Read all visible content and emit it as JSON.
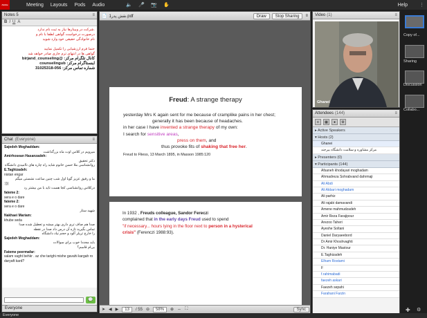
{
  "topbar": {
    "logo": "Adobe",
    "menu": [
      "Meeting",
      "Layouts",
      "Pods",
      "Audio"
    ],
    "help": "Help"
  },
  "notes": {
    "title": "Notes 5",
    "lines": [
      {
        "text": ".شرکت در وبینارها نیاز به ثبت نام ندارد",
        "style": "red"
      },
      {
        "text": "درصورت درخواست گواهی لطفا با نام و",
        "style": "red"
      },
      {
        "text": "نام خانوادگی حقیقی خود وارد شوید",
        "style": "red"
      },
      {
        "text": "",
        "style": ""
      },
      {
        "text": "حتما فرم ارزشیابی را تکمیل نمایید",
        "style": "red"
      },
      {
        "text": "گواهی ها در انتهای ترم جاری صادر خواهد شد",
        "style": "red"
      },
      {
        "text": "کانال تلگرام مرکز: @birjand_counseling",
        "style": "b"
      },
      {
        "text": "اینستاگرام مرکز: counselingub",
        "style": "b"
      },
      {
        "text": "شماره تماس مرکز: 056-31025318",
        "style": "b"
      }
    ]
  },
  "chat": {
    "title": "Chat",
    "scope": "(Everyone)",
    "tab": "Everyone",
    "messages": [
      {
        "who": "Sajedeh Moghaddam:",
        "text": "میرویم در کلاس اوت ماه بزرگداشت",
        "dir": "rtl"
      },
      {
        "who": "Amirhosean Hasanzadeh:",
        "text": "دکتر تحقیق",
        "dir": "rtl"
      },
      {
        "who": "",
        "text": "روانشناسی ملا حسن خانوم شاید راه چاره های ناامیدی دانشگاه",
        "dir": "rtl"
      },
      {
        "who": "E.Taghizadeh:",
        "text": "nistan engar",
        "dir": "ltr"
      },
      {
        "who": "",
        "text": "ما و رفیق عزیز گویا اول شب چنین ساعت نشستی میگم",
        "dir": "rtl"
      },
      {
        "who": "",
        "text": ":)))",
        "dir": "ltr"
      },
      {
        "who": "",
        "text": "درکلاس روانشناسی کجا هست تاید با من بیشتر رد",
        "dir": "rtl"
      },
      {
        "who": "fateme 2:",
        "text": "sera e o dare",
        "dir": "ltr"
      },
      {
        "who": "fateme 2:",
        "text": "sera e o dare",
        "dir": "ltr"
      },
      {
        "who": "",
        "text": "شهید ستار",
        "dir": "rtl"
      },
      {
        "who": "Nakhaei Mariam:",
        "text": "khube seda",
        "dir": "ltr"
      },
      {
        "who": "",
        "text": "صدا هم صاف تری داری بهتر میشه و تعطیل شده صدا",
        "dir": "rtl"
      },
      {
        "who": "",
        "text": "تماس بگیرید تازه آن درس داد صدا در نقطه",
        "dir": "rtl"
      },
      {
        "who": "",
        "text": "را خارج تریلر آلود و حجم نیاد دانشگاه",
        "dir": "rtl"
      },
      {
        "who": "Sajedeh Moghaddam:",
        "text": "باید مجددا خوب برای سوالات",
        "dir": "rtl"
      },
      {
        "who": "",
        "text": "بی‌ام قاسم؟",
        "dir": "rtl"
      },
      {
        "who": "Fateme peermafar:",
        "text": "salam vaght behkr . az che tarighi mishe gavahi kargah ro daryaft kard?",
        "dir": "ltr"
      }
    ]
  },
  "share": {
    "filename": "نقش پدر1.pdf",
    "draw_label": "Draw",
    "stop_label": "Stop Sharing",
    "page_current": "13",
    "page_total": "/ 55",
    "zoom": "58%",
    "sync_label": "Sync"
  },
  "slide1": {
    "title_bold": "Freud",
    "title_rest": ": A strange therapy",
    "l1": "yesterday Mrs K again sent for me because of cramplike pains in her chest;",
    "l2": "generally it has been because of headaches.",
    "l3a": "in her case I have ",
    "l3b": "invented a strange therapy",
    "l3c": " of my own:",
    "l4a": "I search for ",
    "l4b": "sensitive areas",
    "l4c": ",",
    "l5a": "press on them",
    "l5b": ", and",
    "l6a": "thus ",
    "l6b": "provoke fits of ",
    "l6c": "shaking that free her",
    "l6d": ".",
    "cite": "Freud to Fliess, 13 March 1895, in Masson 1985:120"
  },
  "slide2": {
    "l1a": "In 1932 , ",
    "l1b": "Freuds colleague, Sandor Ferecz",
    "l1c": "i",
    "l2a": "complained that ",
    "l2b": "in the early days Freud",
    "l2c": " used to spend",
    "l3a": "\"if necessary... hours lying in the floor next to ",
    "l3b": "person in a hysterical",
    "l4a": "crisis\"",
    "l4b": " (Ferenczi 1988:93)."
  },
  "video": {
    "title": "Video",
    "count": "(1)",
    "name": "Ghanei"
  },
  "attendees": {
    "title": "Attendees",
    "count": "(144)",
    "active_speakers": "Active Speakers",
    "hosts_label": "Hosts (2)",
    "hosts": [
      "Ghanei",
      "مرکز مشاوره و سلامت دانشگاه بیرجند"
    ],
    "presenters_label": "Presenters (0)",
    "participants_label": "Participants (144)",
    "participants": [
      {
        "name": "Afsaneh khodayari moghadam",
        "blue": false
      },
      {
        "name": "Ahmadreza Sohrabvand dahrmaji",
        "blue": false
      },
      {
        "name": "Ali Abdi",
        "blue": true
      },
      {
        "name": "Ali Akbari moghadam",
        "blue": true
      },
      {
        "name": "Ali parhiz",
        "blue": false
      },
      {
        "name": "Ali rajabi damavandi",
        "blue": false
      },
      {
        "name": "Amene mahmudzadeh",
        "blue": false
      },
      {
        "name": "Amir Reza Farajipour",
        "blue": false
      },
      {
        "name": "Arezoo Taheri",
        "blue": false
      },
      {
        "name": "Ayeshe Soltani",
        "blue": false
      },
      {
        "name": "Daniel Daryaeebord",
        "blue": false
      },
      {
        "name": "Dr Amir Khoshvaghti",
        "blue": false
      },
      {
        "name": "Dr. Haniye Mastour",
        "blue": false
      },
      {
        "name": "E.Taghizadeh",
        "blue": false
      },
      {
        "name": "Elham Rostami",
        "blue": true
      },
      {
        "name": "F",
        "blue": false
      },
      {
        "name": "f.rahimabadi",
        "blue": true
      },
      {
        "name": "faezeh askari",
        "blue": true
      },
      {
        "name": "Faezeh sepahi",
        "blue": false
      },
      {
        "name": "Farahani Farzin",
        "blue": true
      }
    ]
  },
  "rail": {
    "thumbs": [
      "Copy of...",
      "Sharing",
      "Discussion",
      "Collabo..."
    ]
  },
  "bottom": {
    "label": "Everyone"
  }
}
